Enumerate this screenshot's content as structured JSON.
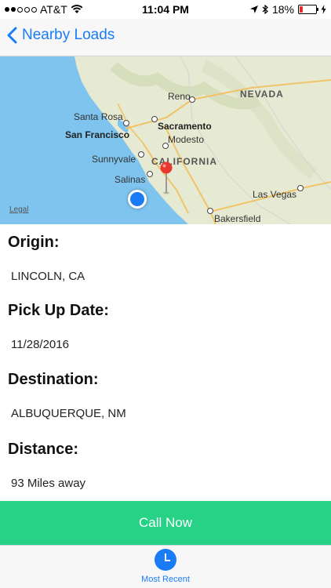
{
  "status_bar": {
    "carrier": "AT&T",
    "time": "11:04 PM",
    "battery": "18%",
    "battery_level": 0.18
  },
  "nav": {
    "back_label": "Nearby Loads"
  },
  "map": {
    "labels": {
      "reno": "Reno",
      "nevada": "NEVADA",
      "santa_rosa": "Santa Rosa",
      "sacramento": "Sacramento",
      "san_francisco": "San Francisco",
      "modesto": "Modesto",
      "sunnyvale": "Sunnyvale",
      "california": "CALIFORNIA",
      "salinas": "Salinas",
      "las_vegas": "Las Vegas",
      "bakersfield": "Bakersfield"
    },
    "legal": "Legal",
    "colors": {
      "water": "#7ec4ee",
      "land": "#e7ead2",
      "user": "#1a7cf5",
      "pin": "#e8382f"
    }
  },
  "load": {
    "origin_label": "Origin:",
    "origin": "LINCOLN, CA",
    "pickup_label": "Pick Up Date:",
    "pickup": "11/28/2016",
    "destination_label": "Destination:",
    "destination": "ALBUQUERQUE, NM",
    "distance_label": "Distance:",
    "distance": "93 Miles away"
  },
  "call_button": {
    "label": "Call Now",
    "color": "#27d186"
  },
  "tab_bar": {
    "items": [
      {
        "label": "Most Recent",
        "icon": "clock-icon"
      }
    ]
  }
}
